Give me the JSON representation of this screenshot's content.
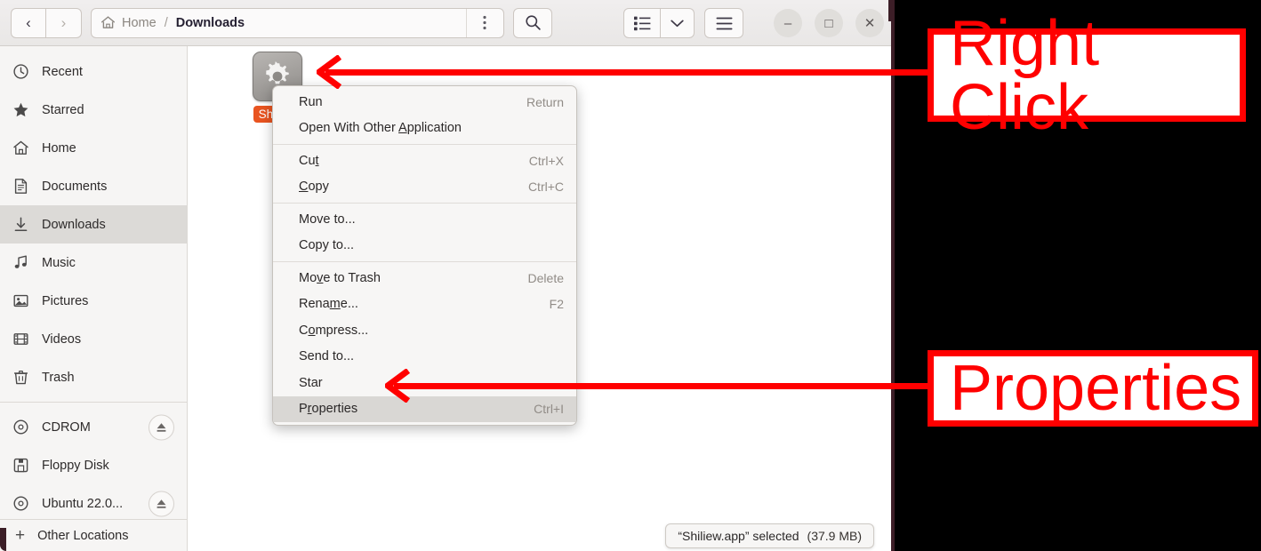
{
  "window": {
    "headerbar": {
      "back_label": "‹",
      "forward_label": "›",
      "path": {
        "home_label": "Home",
        "separator": "/",
        "current_label": "Downloads"
      },
      "options_name": "view-options",
      "search_name": "search",
      "view_list_name": "list-view",
      "view_dropdown_name": "view-dropdown",
      "menu_name": "main-menu",
      "minimize_label": "–",
      "maximize_label": "□",
      "close_label": "✕"
    },
    "sidebar": {
      "items": [
        {
          "label": "Recent",
          "icon": "clock-icon",
          "selected": false,
          "eject": false
        },
        {
          "label": "Starred",
          "icon": "star-icon",
          "selected": false,
          "eject": false
        },
        {
          "label": "Home",
          "icon": "home-icon",
          "selected": false,
          "eject": false
        },
        {
          "label": "Documents",
          "icon": "document-icon",
          "selected": false,
          "eject": false
        },
        {
          "label": "Downloads",
          "icon": "download-icon",
          "selected": true,
          "eject": false
        },
        {
          "label": "Music",
          "icon": "music-icon",
          "selected": false,
          "eject": false
        },
        {
          "label": "Pictures",
          "icon": "picture-icon",
          "selected": false,
          "eject": false
        },
        {
          "label": "Videos",
          "icon": "video-icon",
          "selected": false,
          "eject": false
        },
        {
          "label": "Trash",
          "icon": "trash-icon",
          "selected": false,
          "eject": false
        }
      ],
      "devices": [
        {
          "label": "CDROM",
          "icon": "disc-icon",
          "selected": false,
          "eject": true
        },
        {
          "label": "Floppy Disk",
          "icon": "floppy-icon",
          "selected": false,
          "eject": false
        },
        {
          "label": "Ubuntu 22.0...",
          "icon": "disc-icon",
          "selected": false,
          "eject": true
        }
      ],
      "other_locations": {
        "label": "Other Locations",
        "icon": "plus-icon"
      }
    },
    "content": {
      "file": {
        "name": "Shiliew",
        "icon": "gear-executable-icon",
        "selected": true
      }
    },
    "context_menu": {
      "groups": [
        [
          {
            "label": "Run",
            "mnemonic": "",
            "accel": "Return",
            "highlighted": false
          },
          {
            "label": "Open With Other Application",
            "mnemonic": "A",
            "accel": "",
            "highlighted": false
          }
        ],
        [
          {
            "label": "Cut",
            "mnemonic": "t",
            "accel": "Ctrl+X",
            "highlighted": false
          },
          {
            "label": "Copy",
            "mnemonic": "C",
            "accel": "Ctrl+C",
            "highlighted": false
          }
        ],
        [
          {
            "label": "Move to...",
            "mnemonic": "",
            "accel": "",
            "highlighted": false
          },
          {
            "label": "Copy to...",
            "mnemonic": "",
            "accel": "",
            "highlighted": false
          }
        ],
        [
          {
            "label": "Move to Trash",
            "mnemonic": "v",
            "accel": "Delete",
            "highlighted": false
          },
          {
            "label": "Rename...",
            "mnemonic": "m",
            "accel": "F2",
            "highlighted": false
          },
          {
            "label": "Compress...",
            "mnemonic": "o",
            "accel": "",
            "highlighted": false
          },
          {
            "label": "Send to...",
            "mnemonic": "",
            "accel": "",
            "highlighted": false
          },
          {
            "label": "Star",
            "mnemonic": "",
            "accel": "",
            "highlighted": false
          },
          {
            "label": "Properties",
            "mnemonic": "r",
            "accel": "Ctrl+I",
            "highlighted": true
          }
        ]
      ]
    },
    "statusbar": {
      "selection": "“Shiliew.app” selected",
      "size": "(37.9 MB)"
    }
  },
  "annotations": [
    {
      "text": "Right Click",
      "name": "annotation-right-click"
    },
    {
      "text": "Properties",
      "name": "annotation-properties"
    }
  ],
  "colors": {
    "annotation_red": "#ff0000",
    "selection_orange": "#e95420",
    "sidebar_bg": "#f6f5f4",
    "window_edge": "#3c1e27"
  }
}
